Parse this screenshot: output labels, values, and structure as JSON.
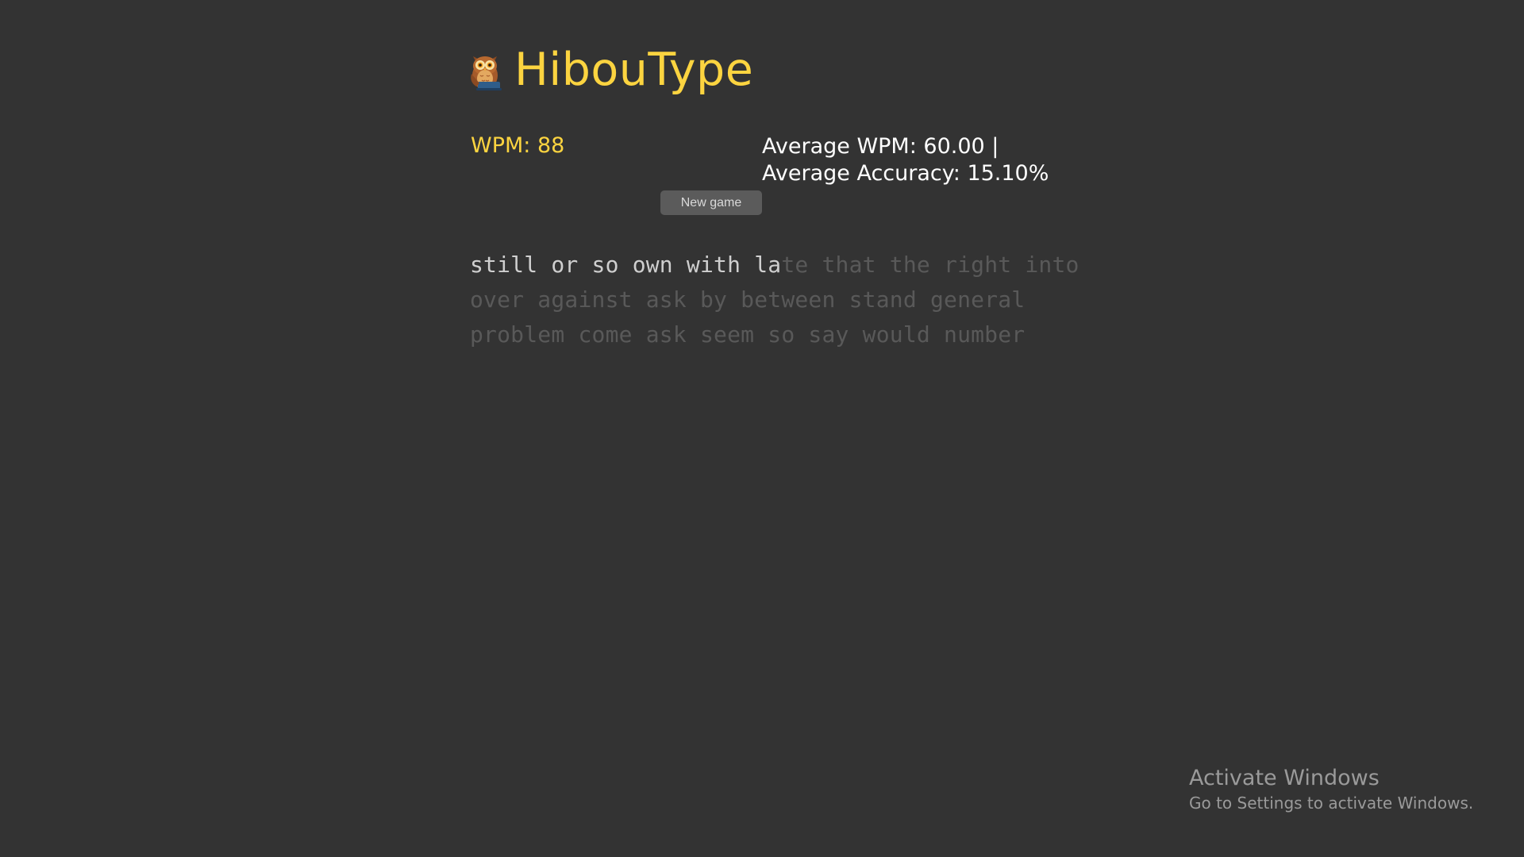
{
  "app": {
    "title": "HibouType",
    "logo_icon": "owl-icon"
  },
  "stats": {
    "wpm": "WPM: 88",
    "average_wpm": "Average WPM: 60.00 |",
    "average_accuracy": "Average Accuracy: 15.10%"
  },
  "controls": {
    "new_game_label": "New game"
  },
  "typing": {
    "lines": [
      {
        "typed": "still or so own with la",
        "untyped": "te that the right into"
      },
      {
        "typed": "",
        "untyped": "over against ask by between stand general"
      },
      {
        "typed": "",
        "untyped": "problem come ask seem so say would number"
      }
    ]
  },
  "watermark": {
    "title": "Activate Windows",
    "subtitle": "Go to Settings to activate Windows."
  },
  "colors": {
    "background": "#333333",
    "accent": "#fcd440",
    "typed_text": "#cfcfcf",
    "untyped_text": "#595959"
  }
}
